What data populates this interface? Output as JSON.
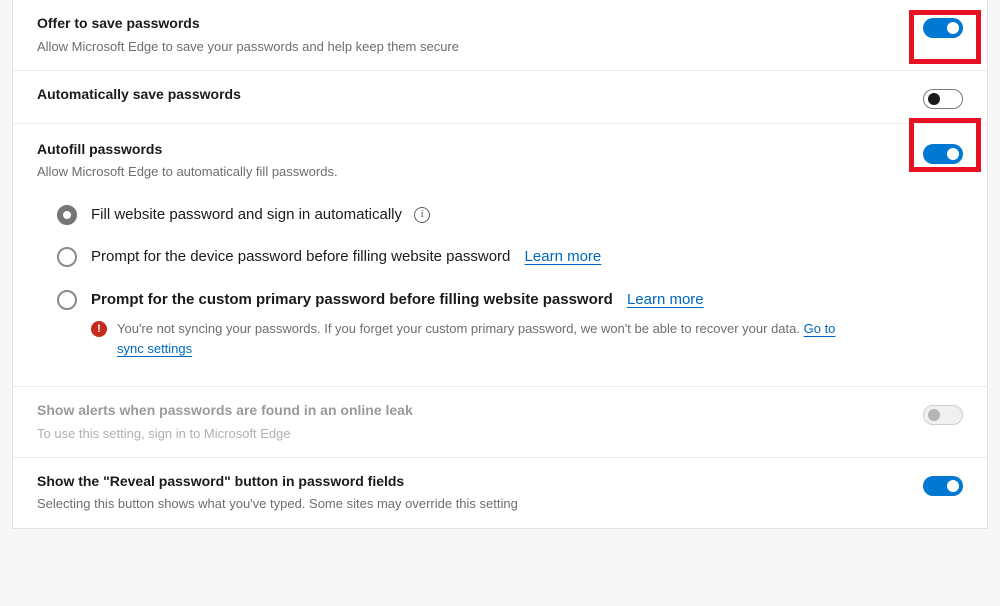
{
  "rows": {
    "offerSave": {
      "title": "Offer to save passwords",
      "desc": "Allow Microsoft Edge to save your passwords and help keep them secure",
      "toggle": "on",
      "highlighted": true
    },
    "autoSave": {
      "title": "Automatically save passwords",
      "toggle": "off"
    },
    "autofill": {
      "title": "Autofill passwords",
      "desc": "Allow Microsoft Edge to automatically fill passwords.",
      "toggle": "on",
      "highlighted": true,
      "options": [
        {
          "label": "Fill website password and sign in automatically",
          "selected": true,
          "infoIcon": true
        },
        {
          "label": "Prompt for the device password before filling website password",
          "selected": false,
          "learnMore": "Learn more"
        },
        {
          "label": "Prompt for the custom primary password before filling website password",
          "selected": false,
          "bold": true,
          "learnMore": "Learn more",
          "warning": {
            "text": "You're not syncing your passwords. If you forget your custom primary password, we won't be able to recover your data. ",
            "linkText": "Go to sync settings"
          }
        }
      ]
    },
    "alerts": {
      "title": "Show alerts when passwords are found in an online leak",
      "desc": "To use this setting, sign in to Microsoft Edge",
      "toggle": "off-disabled",
      "disabled": true
    },
    "reveal": {
      "title": "Show the \"Reveal password\" button in password fields",
      "desc": "Selecting this button shows what you've typed. Some sites may override this setting",
      "toggle": "on"
    }
  }
}
